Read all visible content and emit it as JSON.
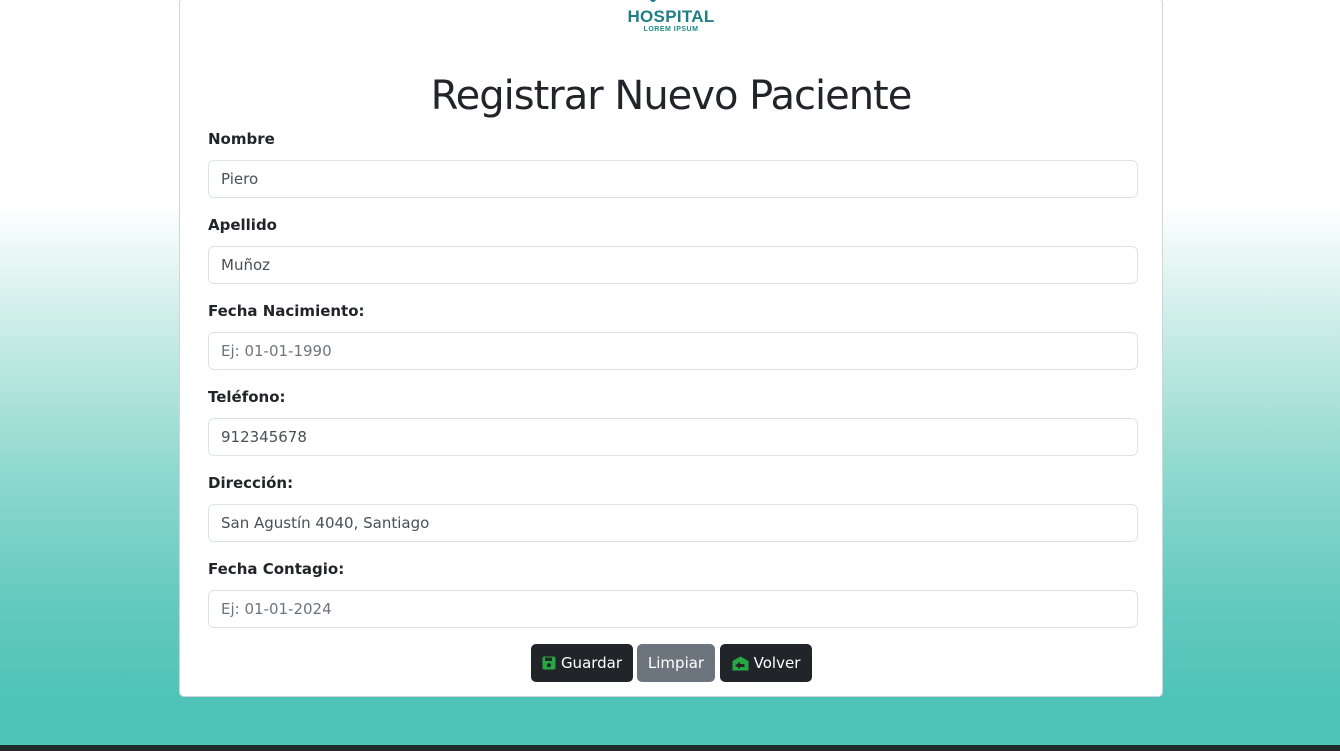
{
  "logo": {
    "name": "HOSPITAL",
    "tagline": "LOREM IPSUM"
  },
  "title": "Registrar Nuevo Paciente",
  "form": {
    "fields": [
      {
        "label": "Nombre",
        "value": "Piero",
        "placeholder": ""
      },
      {
        "label": "Apellido",
        "value": "Muñoz",
        "placeholder": ""
      },
      {
        "label": "Fecha Nacimiento:",
        "value": "",
        "placeholder": "Ej: 01-01-1990"
      },
      {
        "label": "Teléfono:",
        "value": "912345678",
        "placeholder": ""
      },
      {
        "label": "Dirección:",
        "value": "San Agustín 4040, Santiago",
        "placeholder": ""
      },
      {
        "label": "Fecha Contagio:",
        "value": "",
        "placeholder": "Ej: 01-01-2024"
      }
    ]
  },
  "buttons": {
    "save_label": "Guardar",
    "save_icon": "save-icon",
    "clear_label": "Limpiar",
    "back_label": "Volver",
    "back_icon": "back-icon"
  },
  "colors": {
    "brand": "#1e7f8a",
    "accent_icon": "#28a745",
    "dark_button": "#212529",
    "secondary_button": "#6c757d"
  }
}
